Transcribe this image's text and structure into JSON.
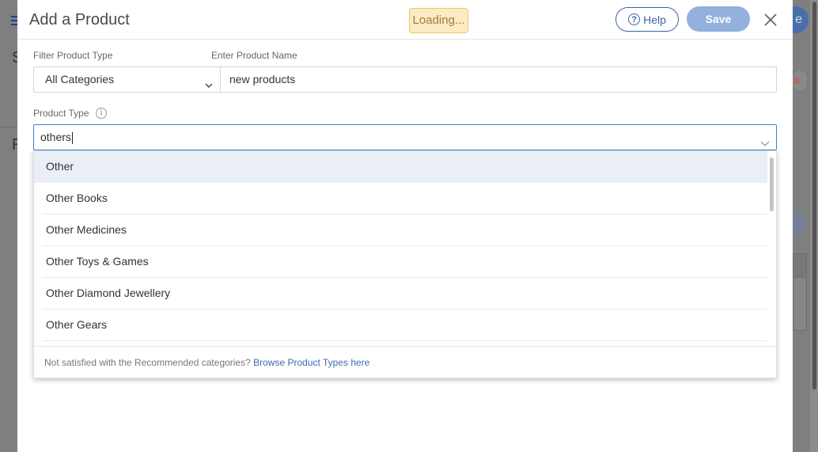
{
  "modal": {
    "title": "Add a Product",
    "loading_text": "Loading...",
    "help_label": "Help",
    "save_label": "Save"
  },
  "filter": {
    "label": "Filter Product Type",
    "selected": "All Categories"
  },
  "product_name": {
    "label": "Enter Product Name",
    "value": "new products"
  },
  "product_type": {
    "label": "Product Type",
    "value": "others"
  },
  "dropdown": {
    "options": [
      "Other",
      "Other Books",
      "Other Medicines",
      "Other Toys & Games",
      "Other Diamond Jewellery",
      "Other Gears"
    ],
    "footer_text": "Not satisfied with the Recommended categories?",
    "footer_link": "Browse Product Types here"
  },
  "background": {
    "letter_s": "S",
    "letter_r": "R",
    "right_btn_glyph": "e"
  },
  "colors": {
    "accent": "#3d63a6",
    "save_disabled": "#93b1dc",
    "loading_bg": "#fcecc4",
    "focus_border": "#3f7fd0",
    "highlight_row": "#eaeef6"
  },
  "icons": [
    "menu-icon",
    "question-icon",
    "close-icon",
    "chevron-down-icon",
    "info-icon"
  ]
}
